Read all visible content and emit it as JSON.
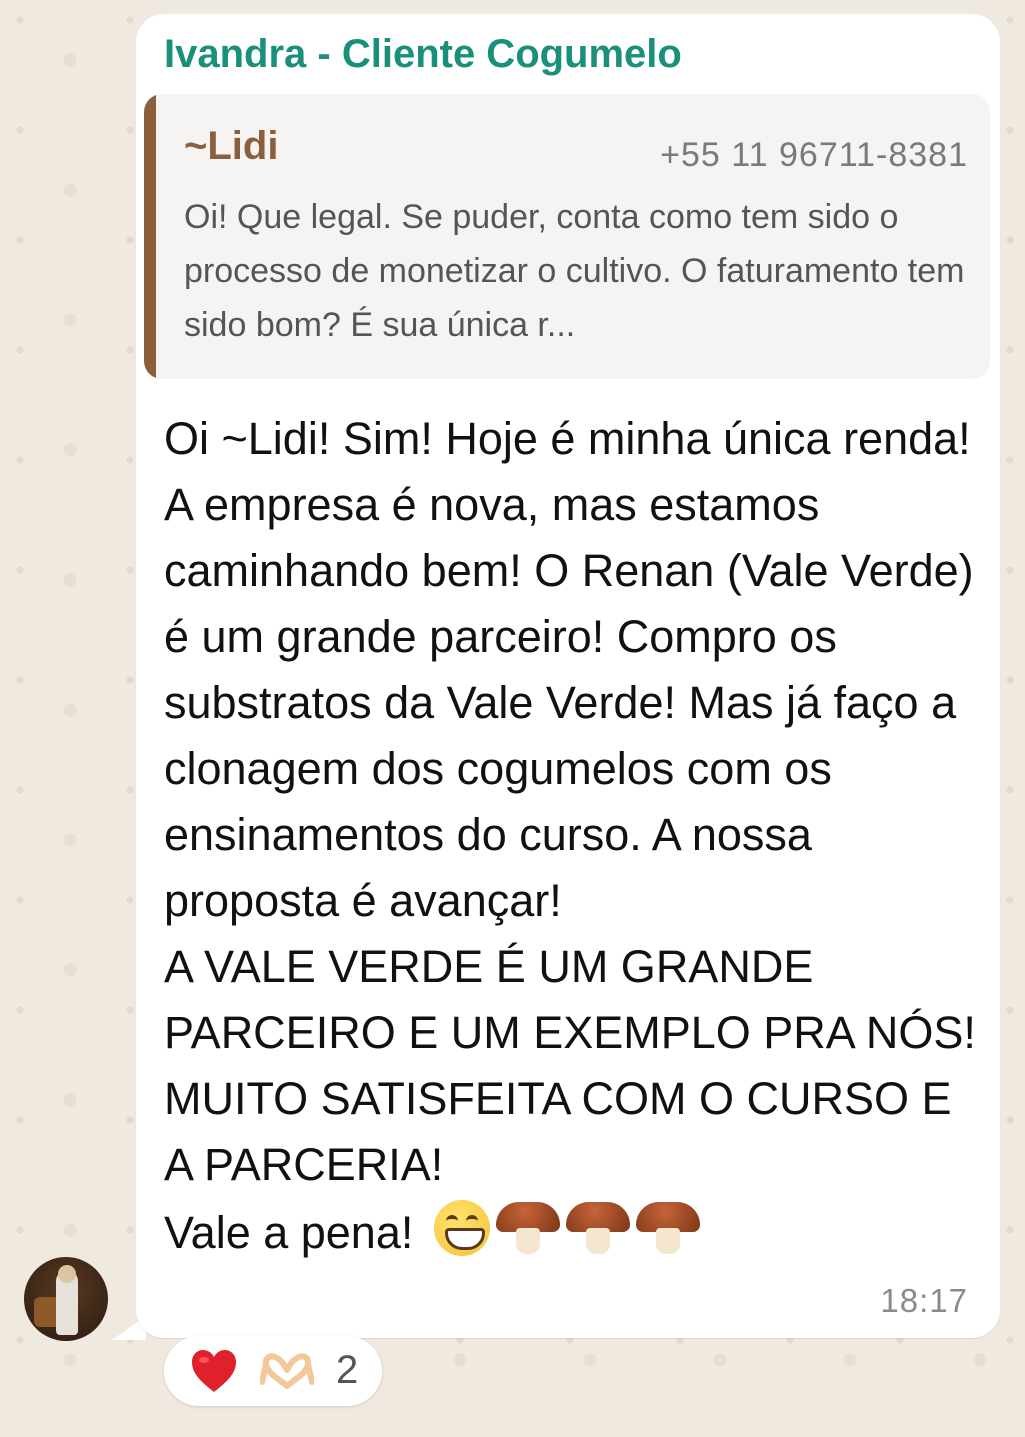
{
  "chat": {
    "sender_name": "Ivandra - Cliente Cogumelo",
    "quoted": {
      "author": "~Lidi",
      "phone": "+55 11 96711-8381",
      "text": "Oi! Que legal. Se puder, conta como tem sido o processo de monetizar o cultivo. O faturamento tem sido bom? É sua única r..."
    },
    "message": {
      "text": "Oi ~Lidi! Sim! Hoje é minha única renda! A empresa é nova, mas estamos caminhando bem! O Renan (Vale Verde) é um grande parceiro! Compro os substratos da Vale Verde! Mas já faço a clonagem dos cogumelos com os ensinamentos do curso. A nossa proposta é avançar!\nA VALE VERDE É UM GRANDE PARCEIRO E UM EXEMPLO PRA NÓS! MUITO SATISFEITA COM O CURSO E A PARCERIA!\nVale a pena! ",
      "emojis": [
        "grinning-face",
        "mushroom",
        "mushroom",
        "mushroom"
      ],
      "time": "18:17"
    },
    "reactions": {
      "emojis": [
        "red-heart",
        "heart-hands"
      ],
      "count": "2"
    }
  },
  "colors": {
    "sender": "#1a8f7a",
    "quote_accent": "#8b5e3c",
    "bubble": "#ffffff",
    "background": "#efe9df"
  }
}
